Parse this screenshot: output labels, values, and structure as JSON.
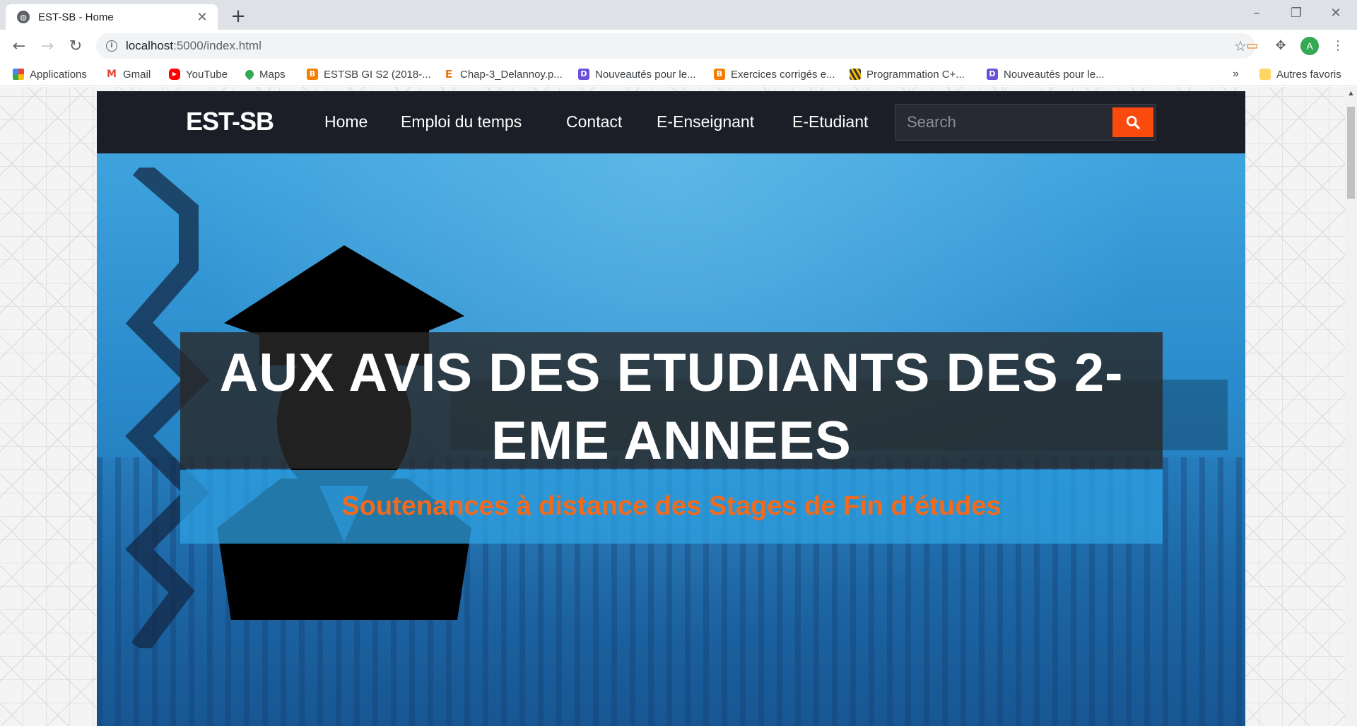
{
  "browser": {
    "tab_title": "EST-SB - Home",
    "tab_favicon": "globe-icon",
    "url_host": "localhost",
    "url_rest": ":5000/index.html",
    "profile_initial": "A",
    "bookmarks": [
      {
        "label": "Applications",
        "icon": "apps-grid-icon"
      },
      {
        "label": "Gmail",
        "icon": "gmail-icon"
      },
      {
        "label": "YouTube",
        "icon": "youtube-icon"
      },
      {
        "label": "Maps",
        "icon": "maps-pin-icon"
      },
      {
        "label": "ESTSB GI S2 (2018-...",
        "icon": "blogger-icon"
      },
      {
        "label": "Chap-3_Delannoy.p...",
        "icon": "e-doc-icon"
      },
      {
        "label": "Nouveautés pour le...",
        "icon": "purple-d-icon"
      },
      {
        "label": "Exercices corrigés e...",
        "icon": "blogger-icon"
      },
      {
        "label": "Programmation C+...",
        "icon": "stripes-icon"
      },
      {
        "label": "Nouveautés pour le...",
        "icon": "purple-d-icon"
      }
    ],
    "bookmarks_overflow": "»",
    "other_bookmarks": "Autres favoris"
  },
  "site": {
    "brand": "EST-SB",
    "nav": [
      "Home",
      "Emploi du temps",
      "Contact",
      "E-Enseignant",
      "E-Etudiant"
    ],
    "search_placeholder": "Search",
    "hero_title": "AUX AVIS DES ETUDIANTS DES 2-EME ANNEES",
    "hero_subtitle": "Soutenances à distance des Stages de Fin d’études"
  },
  "colors": {
    "nav_bg": "#1b1e26",
    "search_button": "#fa4b0f",
    "subtitle": "#f26a1c",
    "hero_blue": "#2a8bcc"
  }
}
